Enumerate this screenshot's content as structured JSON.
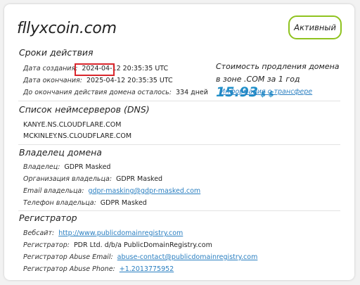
{
  "domain": "fllyxcoin.com",
  "status": "Активный",
  "validity": {
    "title": "Сроки действия",
    "created_label": "Дата создания:",
    "created_value": "2024-04-12 20:35:35 UTC",
    "expires_label": "Дата окончания:",
    "expires_value": "2025-04-12 20:35:35 UTC",
    "remaining_label": "До окончания действия домена осталось:",
    "remaining_value": "334 дней"
  },
  "renewal": {
    "text": "Стоимость продления домена в зоне .COM за 1 год",
    "price": "15.93",
    "currency": "$ $",
    "transfer_link": "Информация о трансфере"
  },
  "dns": {
    "title": "Список неймсерверов (DNS)",
    "servers": [
      "KANYE.NS.CLOUDFLARE.COM",
      "MCKINLEY.NS.CLOUDFLARE.COM"
    ]
  },
  "owner": {
    "title": "Владелец домена",
    "owner_label": "Владелец:",
    "owner_value": "GDPR Masked",
    "org_label": "Организация владельца:",
    "org_value": "GDPR Masked",
    "email_label": "Email владельца:",
    "email_value": "gdpr-masking@gdpr-masked.com",
    "phone_label": "Телефон владельца:",
    "phone_value": "GDPR Masked"
  },
  "registrar": {
    "title": "Регистратор",
    "site_label": "Вебсайт:",
    "site_value": "http://www.publicdomainregistry.com",
    "name_label": "Регистратор:",
    "name_value": "PDR Ltd. d/b/a PublicDomainRegistry.com",
    "abuse_email_label": "Регистратор Abuse Email:",
    "abuse_email_value": "abuse-contact@publicdomainregistry.com",
    "abuse_phone_label": "Регистратор Abuse Phone:",
    "abuse_phone_value": "+1.2013775952"
  },
  "colors": {
    "accent": "#1f8fc9",
    "status_border": "#8fc31f",
    "highlight": "#d9262c",
    "link": "#2a7fc1"
  }
}
